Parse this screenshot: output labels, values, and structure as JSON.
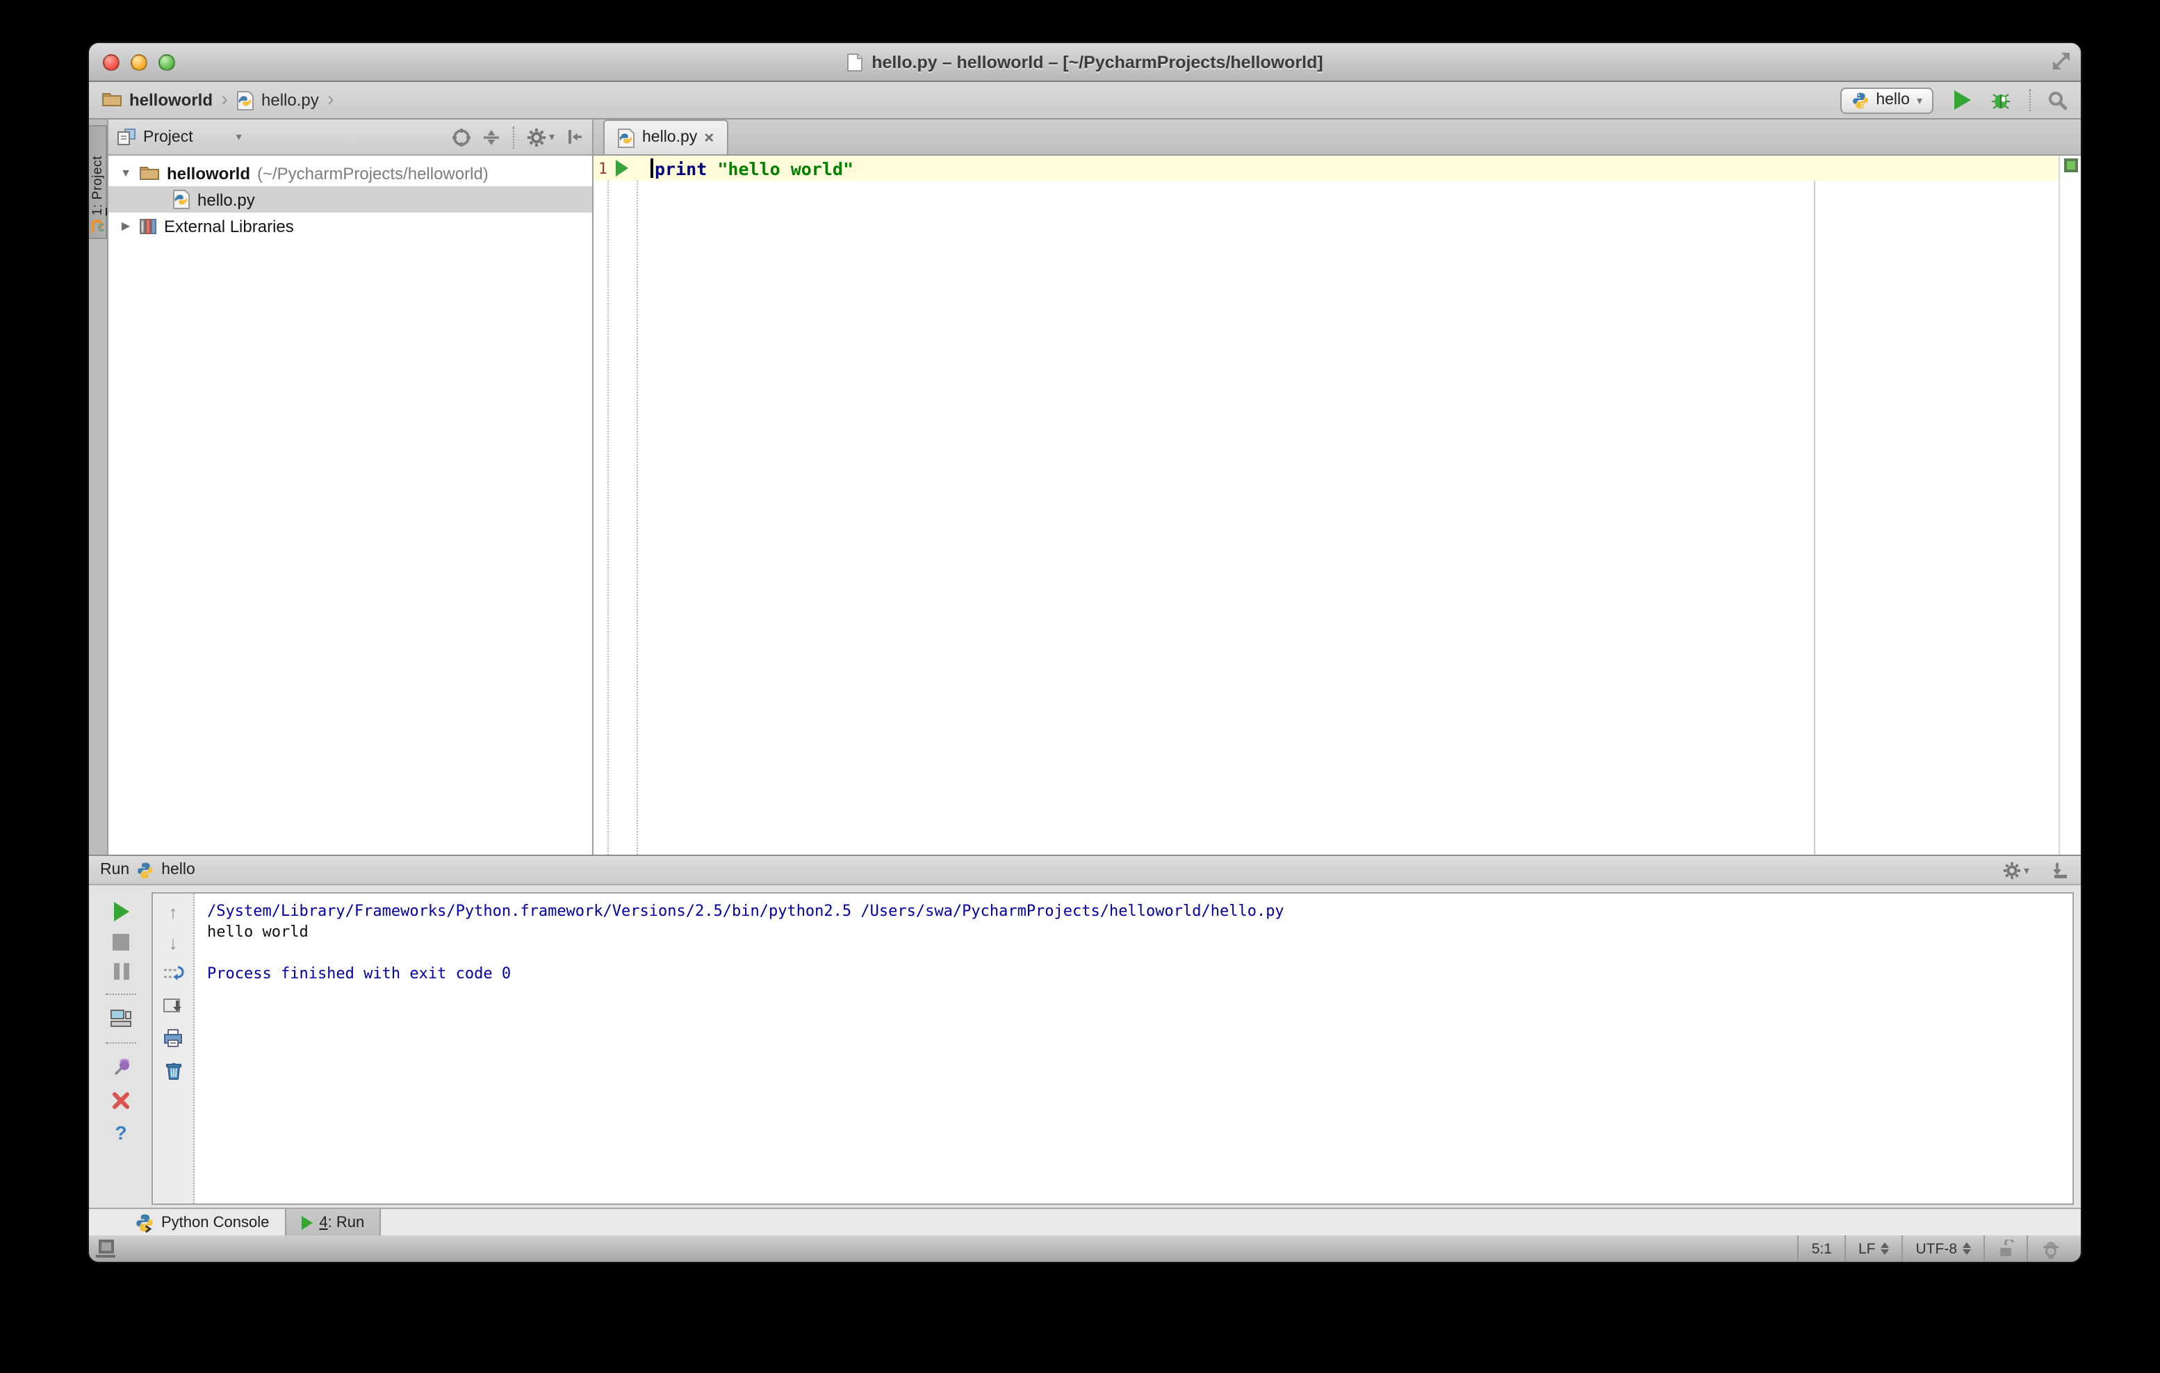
{
  "titlebar": {
    "title": "hello.py – helloworld – [~/PycharmProjects/helloworld]"
  },
  "navbar": {
    "breadcrumb_project": "helloworld",
    "breadcrumb_file": "hello.py",
    "chevron": "›",
    "run_config": "hello",
    "combo_arrow": "▾"
  },
  "project": {
    "stripe_number": "1",
    "stripe_suffix": ": Project",
    "header_title": "Project",
    "header_arrow": "▾",
    "tree": {
      "root_expander": "▼",
      "root_name": "helloworld",
      "root_path": "(~/PycharmProjects/helloworld)",
      "file_name": "hello.py",
      "libs_expander": "▶",
      "libs_label": "External Libraries"
    }
  },
  "editor": {
    "tab_label": "hello.py",
    "tab_close": "×",
    "line_number": "1",
    "code_keyword": "print",
    "code_string": "\"hello world\""
  },
  "run": {
    "header_label": "Run",
    "config_name": "hello",
    "gear_arrow": "▾",
    "console_cmd": "/System/Library/Frameworks/Python.framework/Versions/2.5/bin/python2.5 /Users/swa/PycharmProjects/helloworld/hello.py",
    "console_output": "hello world",
    "console_exit": "Process finished with exit code 0",
    "up_arrow": "↑",
    "down_arrow": "↓",
    "help_glyph": "?"
  },
  "bottom_bar": {
    "python_console_label": "Python Console",
    "run_tab_number": "4",
    "run_tab_suffix": ": Run"
  },
  "status_bar": {
    "caret_position": "5:1",
    "line_separator": "LF",
    "encoding": "UTF-8"
  },
  "colors": {
    "run_green": "#35a535",
    "keyword_blue": "#000080",
    "string_green": "#008000",
    "console_info_blue": "#0000a6",
    "line_highlight": "#fffcd9",
    "selection_gray": "#d2d2d2"
  }
}
